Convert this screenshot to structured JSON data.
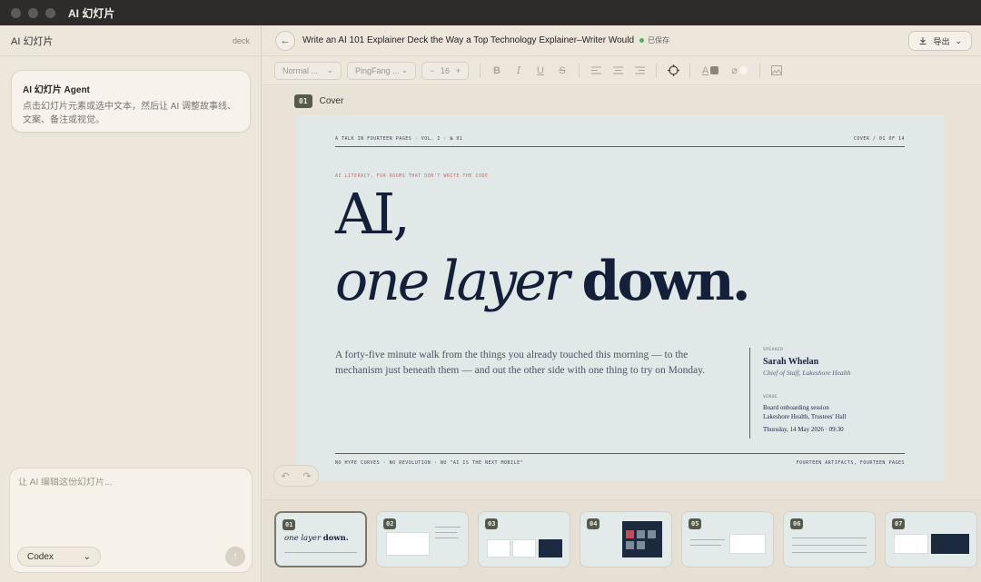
{
  "app": {
    "title": "AI 幻灯片"
  },
  "sidebar": {
    "title": "AI 幻灯片",
    "tag": "deck",
    "agent": {
      "name": "AI 幻灯片 Agent",
      "description": "点击幻灯片元素或选中文本，然后让 AI 调整故事线、文案、备注或视觉。"
    },
    "composer": {
      "placeholder": "让 AI 编辑这份幻灯片...",
      "model": "Codex"
    }
  },
  "header": {
    "doc_title": "Write an AI 101 Explainer Deck the Way a Top Technology Explainer–Writer Would",
    "saved": "已保存",
    "export": "导出"
  },
  "toolbar": {
    "style": "Normal ...",
    "font": "PingFang ...",
    "size": "16",
    "minus": "−",
    "plus": "+"
  },
  "slide": {
    "number": "01",
    "label": "Cover",
    "top_left": "A TALK IN FOURTEEN PAGES · VOL. I · № 01",
    "top_right": "COVER / 01 OF 14",
    "kicker": "AI LITERACY, FOR ROOMS THAT DON'T WRITE THE CODE",
    "headline_1": "AI,",
    "headline_italic": "one layer",
    "headline_bold": "down.",
    "lede": "A forty-five minute walk from the things you already touched this morning — to the mechanism just beneath them — and out the other side with one thing to try on Monday.",
    "speaker_key": "SPEAKER",
    "speaker_name": "Sarah Whelan",
    "speaker_role": "Chief of Staff, Lakeshore Health",
    "venue_key": "VENUE",
    "venue_line1": "Board onboarding session",
    "venue_line2": "Lakeshore Health, Trustees' Hall",
    "venue_date": "Thursday, 14 May 2026 · 09:30",
    "bottom_left": "NO HYPE CURVES · NO REVOLUTION · NO \"AI IS THE NEXT MOBILE\"",
    "bottom_right": "FOURTEEN ARTIFACTS, FOURTEEN PAGES"
  },
  "thumbnails": [
    {
      "number": "01",
      "italic": "one layer",
      "bold": "down."
    },
    {
      "number": "02"
    },
    {
      "number": "03"
    },
    {
      "number": "04"
    },
    {
      "number": "05"
    },
    {
      "number": "06"
    },
    {
      "number": "07"
    }
  ]
}
